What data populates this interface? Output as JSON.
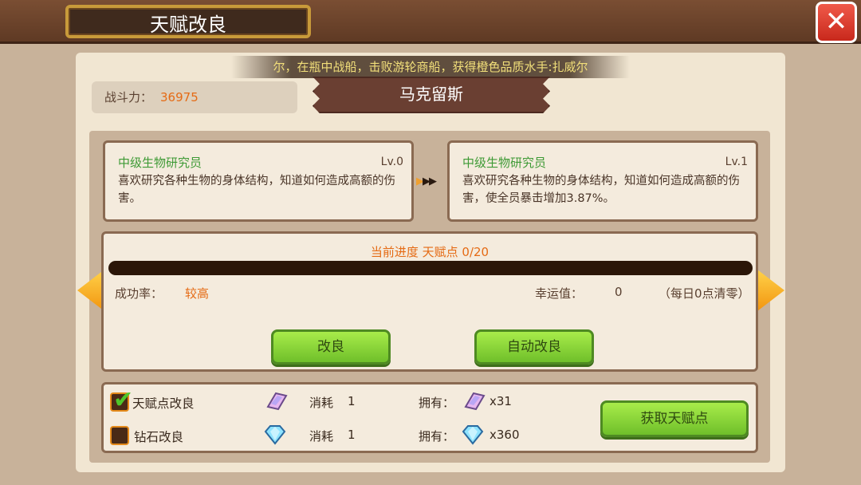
{
  "header": {
    "title": "天赋改良",
    "close_icon": "close-icon"
  },
  "banner": {
    "text": "尔，在瓶中战船，击败游轮商船，获得橙色品质水手:扎威尔"
  },
  "power": {
    "label": "战斗力：",
    "value": "36975"
  },
  "character": {
    "name": "马克留斯"
  },
  "talent_current": {
    "name": "中级生物研究员",
    "level": "Lv.0",
    "desc": "喜欢研究各种生物的身体结构，知道如何造成高额的伤害。"
  },
  "talent_next": {
    "name": "中级生物研究员",
    "level": "Lv.1",
    "desc": "喜欢研究各种生物的身体结构，知道如何造成高额的伤害，使全员暴击增加3.87%。"
  },
  "progress": {
    "label": "当前进度  天赋点   0/20",
    "current": 0,
    "max": 20,
    "fill_fraction": 0.0
  },
  "stats": {
    "success_label": "成功率：",
    "success_value": "较高",
    "luck_label": "幸运值：",
    "luck_value": "0",
    "reset_note": "（每日0点清零）"
  },
  "buttons": {
    "improve": "改良",
    "auto_improve": "自动改良",
    "get_points": "获取天赋点"
  },
  "options": [
    {
      "label": "天赋点改良",
      "checked": true,
      "consume_label": "消耗",
      "consume_value": "1",
      "own_label": "拥有：",
      "own_value": "x31",
      "gem": "pink-crystal-icon"
    },
    {
      "label": "钻石改良",
      "checked": false,
      "consume_label": "消耗",
      "consume_value": "1",
      "own_label": "拥有：",
      "own_value": "x360",
      "gem": "blue-diamond-icon"
    }
  ],
  "colors": {
    "accent_orange": "#e56b15",
    "talent_green": "#3e9a35",
    "button_green": "#8ed83a",
    "banner_text": "#f2df7a"
  }
}
